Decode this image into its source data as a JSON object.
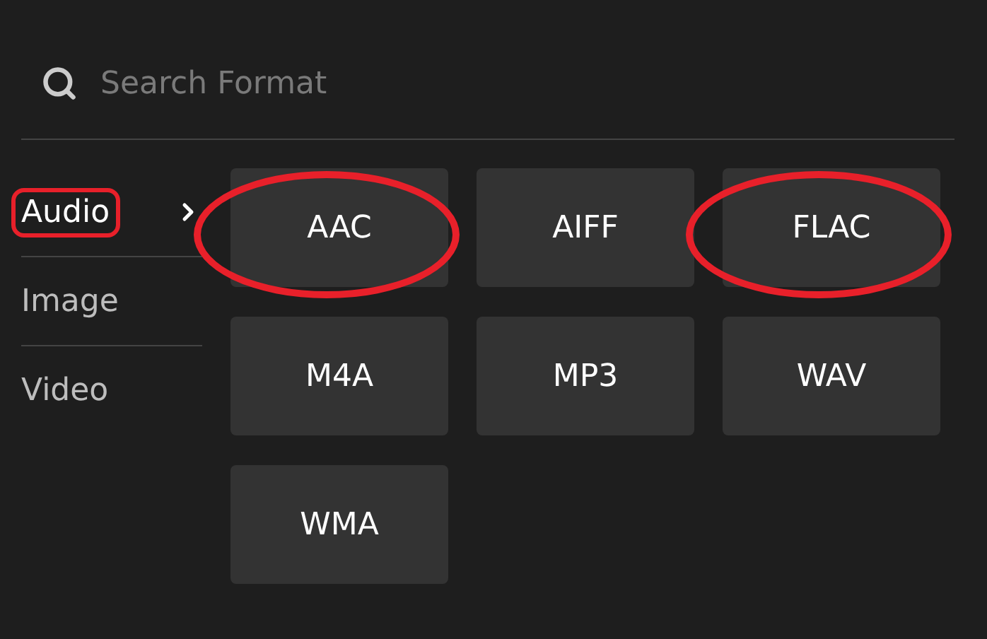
{
  "search": {
    "placeholder": "Search Format"
  },
  "categories": [
    {
      "label": "Audio",
      "selected": true,
      "highlighted": true
    },
    {
      "label": "Image",
      "selected": false,
      "highlighted": false
    },
    {
      "label": "Video",
      "selected": false,
      "highlighted": false
    }
  ],
  "formats": [
    {
      "label": "AAC",
      "highlighted": true
    },
    {
      "label": "AIFF",
      "highlighted": false
    },
    {
      "label": "FLAC",
      "highlighted": true
    },
    {
      "label": "M4A",
      "highlighted": false
    },
    {
      "label": "MP3",
      "highlighted": false
    },
    {
      "label": "WAV",
      "highlighted": false
    },
    {
      "label": "WMA",
      "highlighted": false
    }
  ]
}
